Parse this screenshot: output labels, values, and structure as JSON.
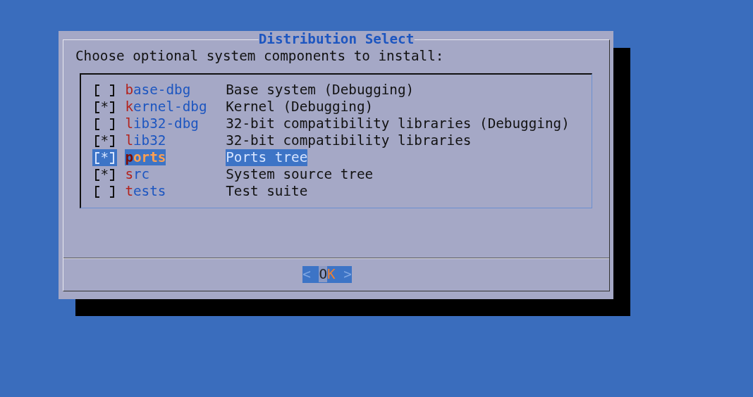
{
  "dialog": {
    "title": "Distribution Select",
    "prompt": "Choose optional system components to install:",
    "checkbox": {
      "mark": "*"
    },
    "items": [
      {
        "name": "base-dbg",
        "description": "Base system (Debugging)",
        "checked": false,
        "selected": false
      },
      {
        "name": "kernel-dbg",
        "description": "Kernel (Debugging)",
        "checked": true,
        "selected": false
      },
      {
        "name": "lib32-dbg",
        "description": "32-bit compatibility libraries (Debugging)",
        "checked": false,
        "selected": false
      },
      {
        "name": "lib32",
        "description": "32-bit compatibility libraries",
        "checked": true,
        "selected": false
      },
      {
        "name": "ports",
        "description": "Ports tree",
        "checked": true,
        "selected": true
      },
      {
        "name": "src",
        "description": "System source tree",
        "checked": true,
        "selected": false
      },
      {
        "name": "tests",
        "description": "Test suite",
        "checked": false,
        "selected": false
      }
    ],
    "buttons": [
      {
        "label": "OK",
        "left": "<",
        "right": ">",
        "selected": true
      }
    ]
  }
}
